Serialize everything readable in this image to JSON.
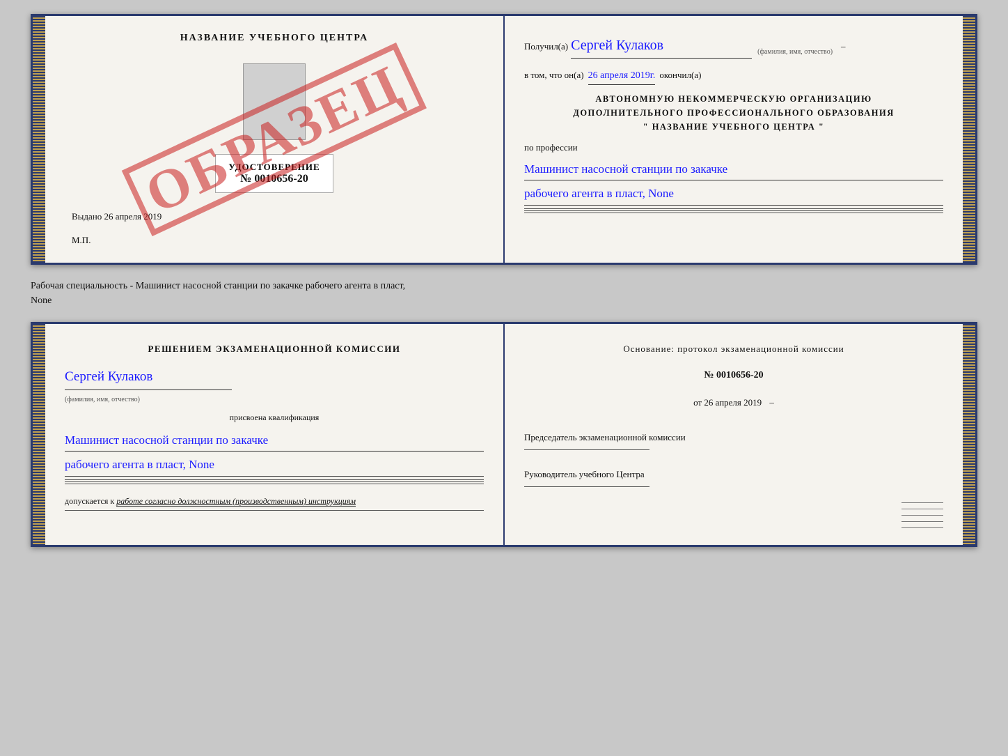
{
  "top_cert": {
    "left": {
      "title": "НАЗВАНИЕ УЧЕБНОГО ЦЕНТРА",
      "stamp": "ОБРАЗЕЦ",
      "udost_label": "УДОСТОВЕРЕНИЕ",
      "udost_number": "№ 0010656-20",
      "vydano": "Выдано 26 апреля 2019",
      "mp": "М.П."
    },
    "right": {
      "poluchil_label": "Получил(а)",
      "poluchil_name": "Сергей Кулаков",
      "fio_hint": "(фамилия, имя, отчество)",
      "vtom_prefix": "в том, что он(а)",
      "vtom_date": "26 апреля 2019г.",
      "okonchil": "окончил(а)",
      "org_line1": "АВТОНОМНУЮ НЕКОММЕРЧЕСКУЮ ОРГАНИЗАЦИЮ",
      "org_line2": "ДОПОЛНИТЕЛЬНОГО ПРОФЕССИОНАЛЬНОГО ОБРАЗОВАНИЯ",
      "org_line3": "\"  НАЗВАНИЕ УЧЕБНОГО ЦЕНТРА  \"",
      "po_professii": "по профессии",
      "prof_line1": "Машинист насосной станции по закачке",
      "prof_line2": "рабочего агента в пласт, None"
    }
  },
  "subtitle": {
    "text": "Рабочая специальность - Машинист насосной станции по закачке рабочего агента в пласт,",
    "text2": "None"
  },
  "bottom_cert": {
    "left": {
      "reshenie_title": "Решением экзаменационной комиссии",
      "name": "Сергей Кулаков",
      "fio_hint": "(фамилия, имя, отчество)",
      "prisvoena": "присвоена квалификация",
      "prof_line1": "Машинист насосной станции по закачке",
      "prof_line2": "рабочего агента в пласт, None",
      "dopusk_prefix": "допускается к",
      "dopusk_text": "работе согласно должностным (производственным) инструкциям"
    },
    "right": {
      "osnovanie_label": "Основание: протокол экзаменационной комиссии",
      "number": "№ 0010656-20",
      "ot_prefix": "от",
      "ot_date": "26 апреля 2019",
      "predsedatel_label": "Председатель экзаменационной комиссии",
      "rukovoditel_label": "Руководитель учебного Центра"
    }
  }
}
